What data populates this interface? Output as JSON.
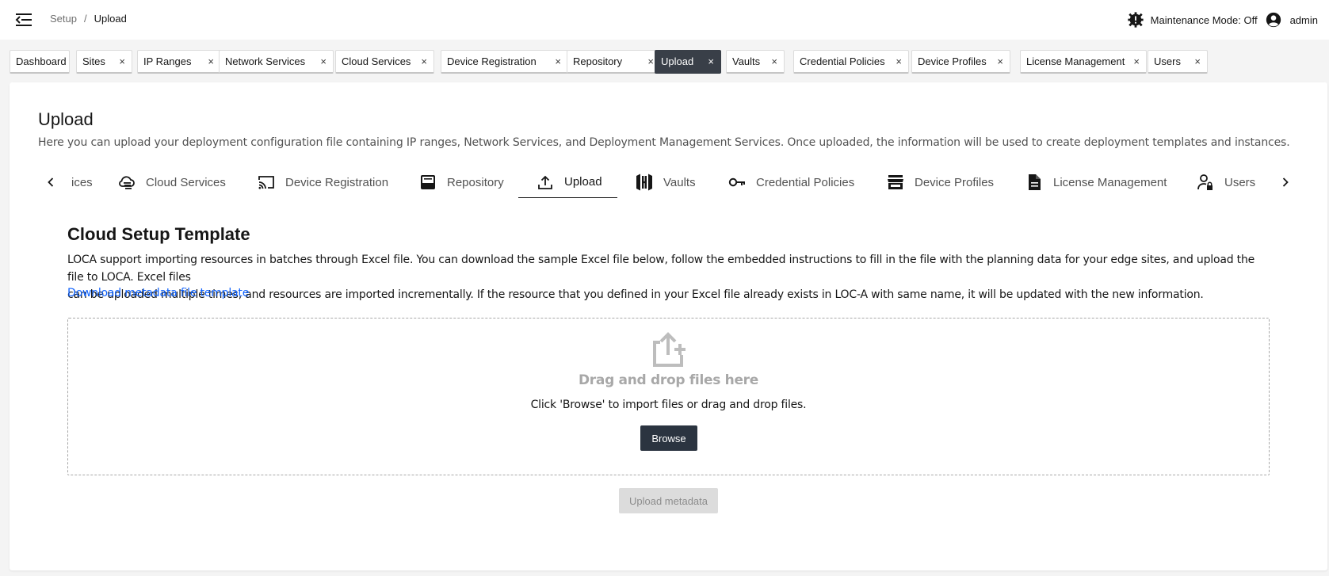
{
  "header": {
    "breadcrumb": [
      "Setup",
      "Upload"
    ],
    "breadcrumb_sep": "/",
    "maintenance": "Maintenance Mode: Off",
    "user": "admin",
    "icons": {
      "menu": "menu-collapse-icon",
      "maintenance": "maintenance-gear-icon",
      "user": "user-avatar-icon"
    }
  },
  "open_tabs": [
    {
      "label": "Dashboard",
      "closable": false
    },
    {
      "label": "Sites",
      "closable": true
    },
    {
      "label": "IP Ranges",
      "closable": true
    },
    {
      "label": "Network Services",
      "closable": true
    },
    {
      "label": "Cloud Services",
      "closable": true
    },
    {
      "label": "Device Registration",
      "closable": true
    },
    {
      "label": "Repository",
      "closable": true
    },
    {
      "label": "Upload",
      "closable": true,
      "active": true
    },
    {
      "label": "Vaults",
      "closable": true
    },
    {
      "label": "Credential Policies",
      "closable": true
    },
    {
      "label": "Device Profiles",
      "closable": true
    },
    {
      "label": "License Management",
      "closable": true
    },
    {
      "label": "Users",
      "closable": true
    }
  ],
  "close_glyph": "×",
  "page": {
    "title": "Upload",
    "description": "Here you can upload your deployment configuration file containing IP ranges, Network Services, and Deployment Management Services. Once uploaded, the information will be used to create deployment templates and instances."
  },
  "subnav": [
    {
      "label": "ices",
      "icon": null
    },
    {
      "label": "Cloud Services",
      "icon": "cloud-services-icon"
    },
    {
      "label": "Device Registration",
      "icon": "cast-icon"
    },
    {
      "label": "Repository",
      "icon": "inbox-tray-icon"
    },
    {
      "label": "Upload",
      "icon": "upload-icon",
      "active": true
    },
    {
      "label": "Vaults",
      "icon": "vault-logo-icon"
    },
    {
      "label": "Credential Policies",
      "icon": "key-icon"
    },
    {
      "label": "Device Profiles",
      "icon": "store-icon"
    },
    {
      "label": "License Management",
      "icon": "document-icon"
    },
    {
      "label": "Users",
      "icon": "user-lock-icon"
    }
  ],
  "content": {
    "section_title": "Cloud Setup Template",
    "text_line1": "LOCA support importing resources in batches through Excel file. You can download the sample Excel file below, follow the embedded instructions to fill in the file with the planning data for your edge sites, and upload the file to LOCA. Excel files",
    "text_line2": "can be uploaded multiple times, and resources are imported incrementally. If the resource that you defined in your Excel file already exists in LOC-A with same name, it will be updated with the new information.",
    "download_link": "Download metadata file template",
    "dropzone_title": "Drag and drop files here",
    "dropzone_hint": "Click 'Browse' to import files or drag and drop files.",
    "browse_label": "Browse",
    "upload_label": "Upload metadata"
  },
  "colors": {
    "link": "#0f62fe",
    "active_tab": "#393f48",
    "browse_button": "#2b3440",
    "disabled_button": "#dcdcdc"
  }
}
